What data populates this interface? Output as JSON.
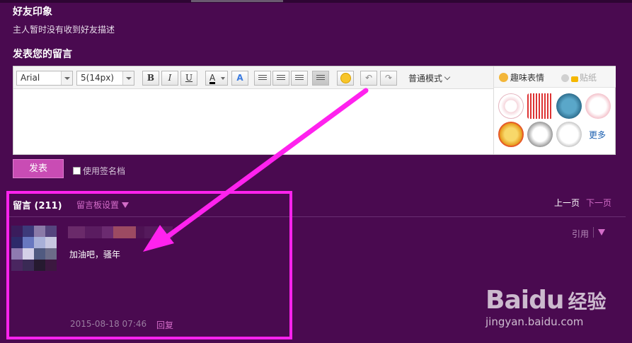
{
  "impression": {
    "title": "好友印象",
    "empty_text": "主人暂时没有收到好友描述"
  },
  "compose": {
    "title": "发表您的留言",
    "font_family": "Arial",
    "font_size": "5(14px)",
    "bold": "B",
    "italic": "I",
    "underline": "U",
    "font_color": "A",
    "highlight": "A",
    "mode": "普通模式",
    "emoji_tabs": {
      "fun": "趣味表情",
      "stickers": "贴纸"
    },
    "more": "更多",
    "submit": "发表",
    "signature": "使用签名档"
  },
  "messages": {
    "title": "留言 (211)",
    "settings": "留言板设置",
    "prev": "上一页",
    "next": "下一页",
    "items": [
      {
        "text": "加油吧，骚年",
        "time": "2015-08-18 07:46",
        "reply": "回复",
        "quote": "引用"
      }
    ]
  },
  "watermark": {
    "logo": "Bai",
    "logo_du": "du",
    "cn": "经验",
    "url": "jingyan.baidu.com"
  },
  "colors": {
    "background": "#4a0a50",
    "accent": "#d36cc8",
    "annotation": "#ff22ee"
  }
}
